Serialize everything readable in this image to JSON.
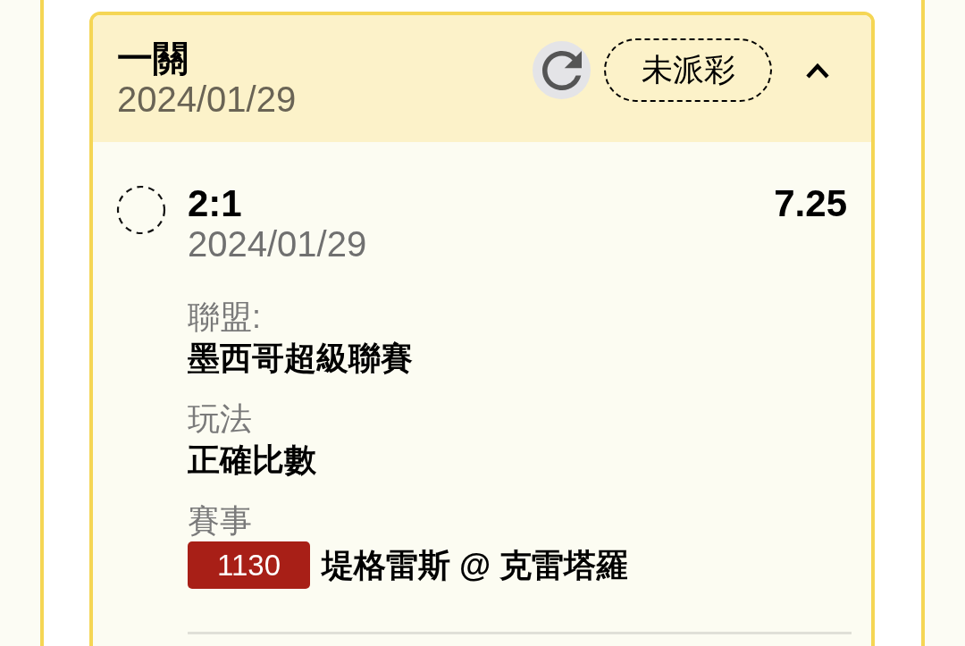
{
  "bet": {
    "title": "一關",
    "date": "2024/01/29",
    "status_tag": "未派彩",
    "expanded": true,
    "selections": [
      {
        "score": "2:1",
        "odds": "7.25",
        "date": "2024/01/29",
        "settled": false,
        "fields": [
          {
            "label": "聯盟:",
            "value": "墨西哥超級聯賽"
          },
          {
            "label": "玩法",
            "value": "正確比數"
          },
          {
            "label": "賽事",
            "match_number": "1130",
            "value": "堤格雷斯 @ 克雷塔羅"
          }
        ]
      }
    ]
  }
}
